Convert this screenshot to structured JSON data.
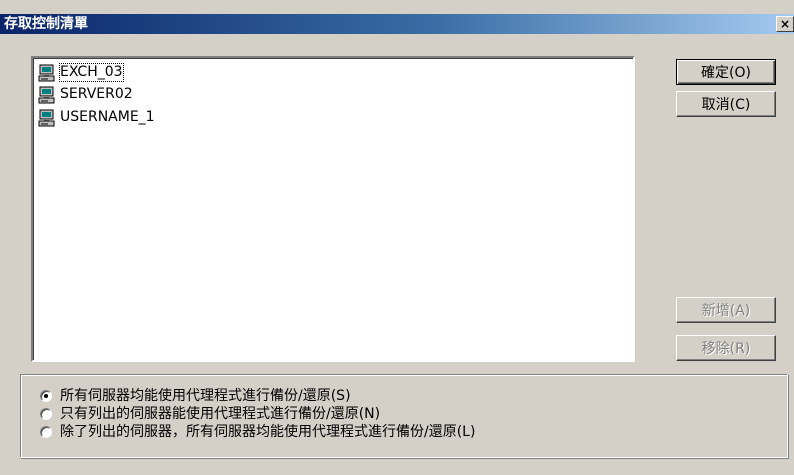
{
  "window": {
    "title": "存取控制清單",
    "close_glyph": "×"
  },
  "list": {
    "items": [
      {
        "label": "EXCH_03",
        "icon": "computer-icon",
        "focused": true
      },
      {
        "label": "SERVER02",
        "icon": "computer-icon",
        "focused": false
      },
      {
        "label": "USERNAME_1",
        "icon": "computer-icon",
        "focused": false
      }
    ]
  },
  "buttons": {
    "ok": "確定(O)",
    "cancel": "取消(C)",
    "add": "新增(A)",
    "remove": "移除(R)"
  },
  "options": {
    "selected_index": 0,
    "items": [
      {
        "label": "所有伺服器均能使用代理程式進行備份/還原(S)"
      },
      {
        "label": "只有列出的伺服器能使用代理程式進行備份/還原(N)"
      },
      {
        "label": "除了列出的伺服器，所有伺服器均能使用代理程式進行備份/還原(L)"
      }
    ]
  },
  "colors": {
    "titlebar_start": "#0a246a",
    "titlebar_end": "#a6caf0",
    "dialog_bg": "#d4d0c8"
  }
}
